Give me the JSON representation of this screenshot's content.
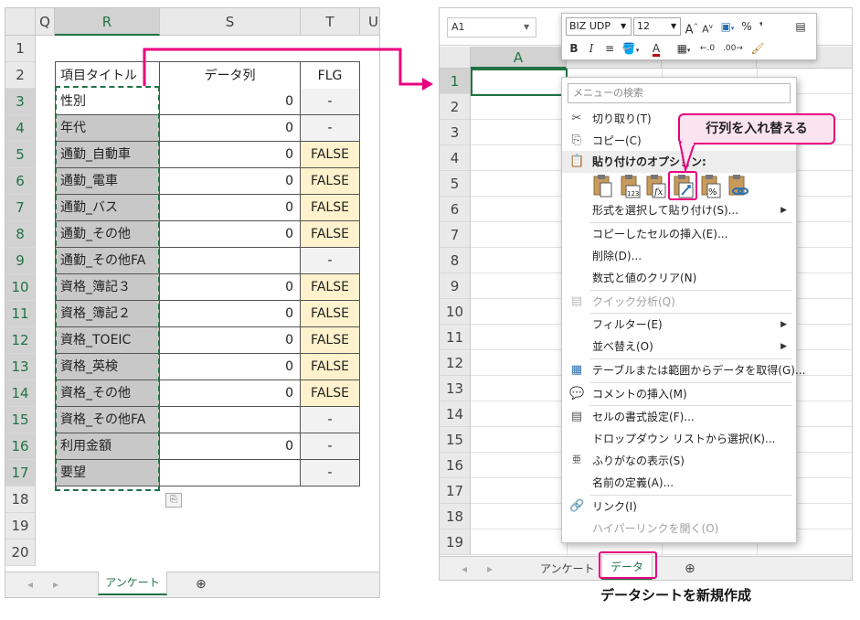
{
  "left_sheet": {
    "columns": [
      "Q",
      "R",
      "S",
      "T",
      "U"
    ],
    "rows": [
      "1",
      "2",
      "3",
      "4",
      "5",
      "6",
      "7",
      "8",
      "9",
      "10",
      "11",
      "12",
      "13",
      "14",
      "15",
      "16",
      "17",
      "18",
      "19",
      "20"
    ],
    "headers": {
      "title": "項目タイトル",
      "data": "データ列",
      "flg": "FLG"
    },
    "items": [
      {
        "title": "性別",
        "value": "0",
        "flg": "-"
      },
      {
        "title": "年代",
        "value": "0",
        "flg": "-"
      },
      {
        "title": "通勤_自動車",
        "value": "0",
        "flg": "FALSE"
      },
      {
        "title": "通勤_電車",
        "value": "0",
        "flg": "FALSE"
      },
      {
        "title": "通勤_バス",
        "value": "0",
        "flg": "FALSE"
      },
      {
        "title": "通勤_その他",
        "value": "0",
        "flg": "FALSE"
      },
      {
        "title": "通勤_その他FA",
        "value": "",
        "flg": "-"
      },
      {
        "title": "資格_簿記３",
        "value": "0",
        "flg": "FALSE"
      },
      {
        "title": "資格_簿記２",
        "value": "0",
        "flg": "FALSE"
      },
      {
        "title": "資格_TOEIC",
        "value": "0",
        "flg": "FALSE"
      },
      {
        "title": "資格_英検",
        "value": "0",
        "flg": "FALSE"
      },
      {
        "title": "資格_その他",
        "value": "0",
        "flg": "FALSE"
      },
      {
        "title": "資格_その他FA",
        "value": "",
        "flg": "-"
      },
      {
        "title": "利用金額",
        "value": "0",
        "flg": "-"
      },
      {
        "title": "要望",
        "value": "",
        "flg": "-"
      }
    ],
    "sheet_tab": "アンケート"
  },
  "right_sheet": {
    "name_box": "A1",
    "columns": [
      "A"
    ],
    "rows": [
      "1",
      "2",
      "3",
      "4",
      "5",
      "6",
      "7",
      "8",
      "9",
      "10",
      "11",
      "12",
      "13",
      "14",
      "15",
      "16",
      "17",
      "18",
      "19"
    ],
    "tabs": [
      "アンケート",
      "データ"
    ]
  },
  "mini_toolbar": {
    "font": "BIZ UDP",
    "size": "12",
    "bold": "B",
    "italic": "I",
    "percent": "%",
    "comma": "❜"
  },
  "context_menu": {
    "search_placeholder": "メニューの検索",
    "cut": "切り取り(T)",
    "copy": "コピー(C)",
    "paste_options": "貼り付けのオプション:",
    "paste_special": "形式を選択して貼り付け(S)...",
    "insert_copied": "コピーしたセルの挿入(E)...",
    "delete": "削除(D)...",
    "clear": "数式と値のクリア(N)",
    "quick_analysis": "クイック分析(Q)",
    "filter": "フィルター(E)",
    "sort": "並べ替え(O)",
    "get_data": "テーブルまたは範囲からデータを取得(G)...",
    "insert_comment": "コメントの挿入(M)",
    "format_cells": "セルの書式設定(F)...",
    "dropdown": "ドロップダウン リストから選択(K)...",
    "phonetic": "ふりがなの表示(S)",
    "define_name": "名前の定義(A)...",
    "link": "リンク(I)",
    "open_hyperlink": "ハイパーリンクを開く(O)"
  },
  "callouts": {
    "transpose": "行列を入れ替える",
    "new_sheet": "データシートを新規作成"
  },
  "colors": {
    "excel_green": "#217346",
    "highlight_pink": "#e8007f",
    "false_fill": "#fff2cc",
    "title_gray": "#c8c8c8"
  }
}
